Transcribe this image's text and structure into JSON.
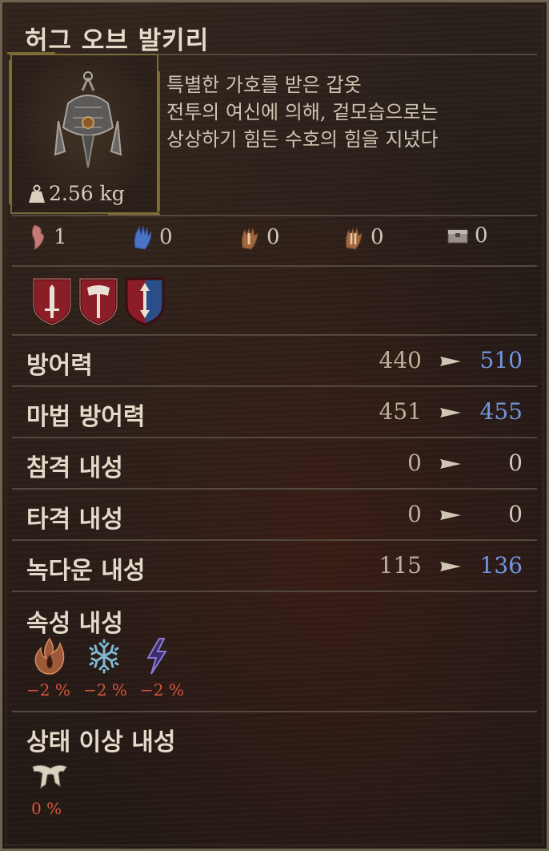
{
  "item": {
    "name": "허그 오브 발키리",
    "weight": "2.56 kg",
    "description": "특별한 가호를 받은 갑옷\n전투의 여신에 의해, 겉모습으로는\n상상하기 힘든 수호의 힘을 지녔다"
  },
  "requirements": [
    {
      "icon": "strength-arm-icon",
      "value": "1"
    },
    {
      "icon": "blue-hand-icon",
      "value": "0"
    },
    {
      "icon": "hand-one-icon",
      "value": "0"
    },
    {
      "icon": "hand-two-icon",
      "value": "0"
    },
    {
      "icon": "chest-icon",
      "value": "0"
    }
  ],
  "badges": [
    "sword-shield-icon",
    "axe-shield-icon",
    "arrows-shield-icon"
  ],
  "stats": [
    {
      "label": "방어력",
      "current": "440",
      "new": "510",
      "changed": true
    },
    {
      "label": "마법 방어력",
      "current": "451",
      "new": "455",
      "changed": true
    },
    {
      "label": "참격 내성",
      "current": "0",
      "new": "0",
      "changed": false
    },
    {
      "label": "타격 내성",
      "current": "0",
      "new": "0",
      "changed": false
    },
    {
      "label": "녹다운 내성",
      "current": "115",
      "new": "136",
      "changed": true
    }
  ],
  "elemental": {
    "title": "속성 내성",
    "items": [
      {
        "icon": "fire-icon",
        "value": "−2 %"
      },
      {
        "icon": "frost-icon",
        "value": "−2 %"
      },
      {
        "icon": "lightning-icon",
        "value": "−2 %"
      }
    ]
  },
  "status_ailment": {
    "title": "상태 이상 내성",
    "items": [
      {
        "icon": "ailment-icon",
        "value": "0 %"
      }
    ]
  },
  "colors": {
    "increase": "#6f97e0",
    "neutral": "#d0c8b8",
    "negative": "#d9573c"
  }
}
